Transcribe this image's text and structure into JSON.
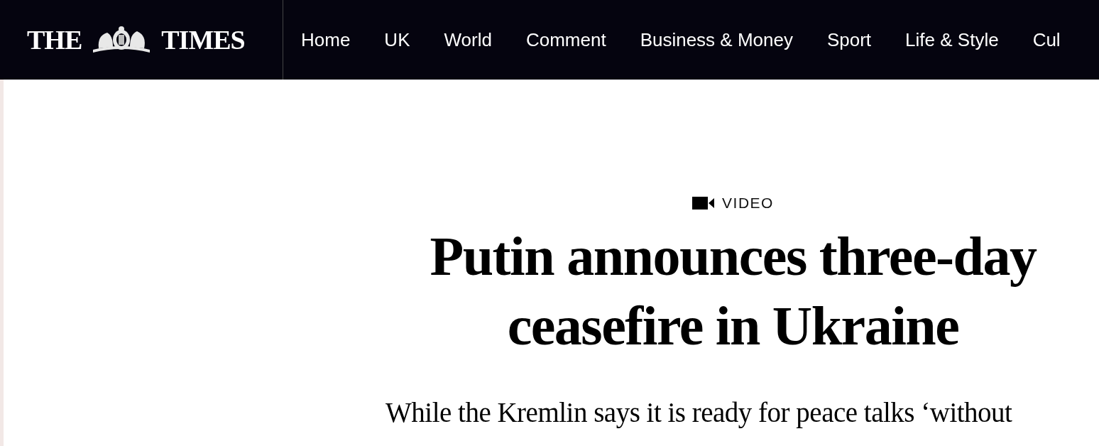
{
  "masthead": {
    "logo_left": "THE",
    "logo_right": "TIMES"
  },
  "nav": {
    "items": [
      {
        "label": "Home"
      },
      {
        "label": "UK"
      },
      {
        "label": "World"
      },
      {
        "label": "Comment"
      },
      {
        "label": "Business & Money"
      },
      {
        "label": "Sport"
      },
      {
        "label": "Life & Style"
      },
      {
        "label": "Cul"
      }
    ]
  },
  "article": {
    "label": "VIDEO",
    "headline": "Putin announces three-day ceasefire in Ukraine",
    "standfirst": "While the Kremlin says it is ready for peace talks ‘without"
  }
}
